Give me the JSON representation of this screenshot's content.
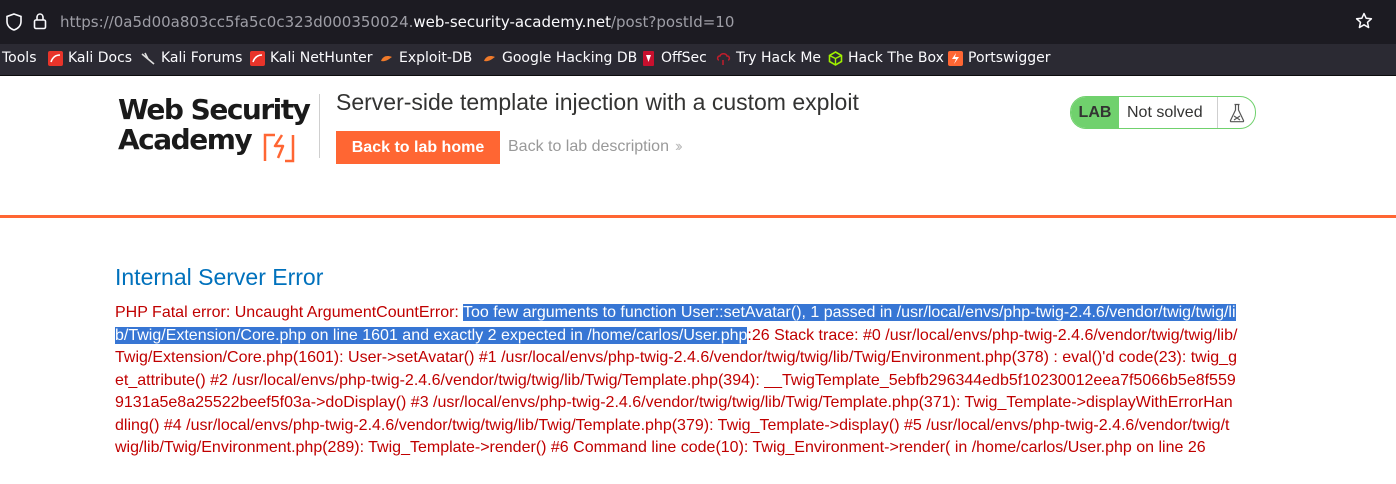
{
  "browser": {
    "url_prefix": "https://0a5d00a803cc5fa5c0c323d000350024.",
    "url_host": "web-security-academy.net",
    "url_path": "/post?postId=10",
    "bookmarks": [
      {
        "label": "Tools",
        "icon": "none"
      },
      {
        "label": "Kali Docs",
        "icon": "kali-icon"
      },
      {
        "label": "Kali Forums",
        "icon": "kali-dragon-icon"
      },
      {
        "label": "Kali NetHunter",
        "icon": "kali-icon"
      },
      {
        "label": "Exploit-DB",
        "icon": "exploitdb-icon"
      },
      {
        "label": "Google Hacking DB",
        "icon": "exploitdb-icon"
      },
      {
        "label": "OffSec",
        "icon": "offsec-icon"
      },
      {
        "label": "Try Hack Me",
        "icon": "tryhackme-icon"
      },
      {
        "label": "Hack The Box",
        "icon": "hackthebox-icon"
      },
      {
        "label": "Portswigger",
        "icon": "portswigger-icon"
      }
    ]
  },
  "header": {
    "logo_line1": "Web Security",
    "logo_line2": "Academy",
    "lab_title": "Server-side template injection with a custom exploit",
    "back_home": "Back to lab home",
    "back_description": "Back to lab description",
    "status_label": "LAB",
    "status_text": "Not solved"
  },
  "error": {
    "title": "Internal Server Error",
    "prefix": " PHP Fatal error: Uncaught ArgumentCountError: ",
    "selected": "Too few arguments to function User::setAvatar(), 1 passed in /usr/local/envs/php-twig-2.4.6/vendor/twig/twig/lib/Twig/Extension/Core.php on line 1601 and exactly 2 expected in /home/carlos/User.php",
    "rest": ":26 Stack trace: #0 /usr/local/envs/php-twig-2.4.6/vendor/twig/twig/lib/Twig/Extension/Core.php(1601): User->setAvatar() #1 /usr/local/envs/php-twig-2.4.6/vendor/twig/twig/lib/Twig/Environment.php(378) : eval()'d code(23): twig_get_attribute() #2 /usr/local/envs/php-twig-2.4.6/vendor/twig/twig/lib/Twig/Template.php(394): __TwigTemplate_5ebfb296344edb5f10230012eea7f5066b5e8f5599131a5e8a25522beef5f03a->doDisplay() #3 /usr/local/envs/php-twig-2.4.6/vendor/twig/twig/lib/Twig/Template.php(371): Twig_Template->displayWithErrorHandling() #4 /usr/local/envs/php-twig-2.4.6/vendor/twig/twig/lib/Twig/Template.php(379): Twig_Template->display() #5 /usr/local/envs/php-twig-2.4.6/vendor/twig/twig/lib/Twig/Environment.php(289): Twig_Template->render() #6 Command line code(10): Twig_Environment->render( in /home/carlos/User.php on line 26"
  },
  "colors": {
    "accent": "#ff6633",
    "error_red": "#c00000",
    "title_blue": "#0071bc",
    "status_green": "#70d16d",
    "selection": "#3776d4"
  }
}
